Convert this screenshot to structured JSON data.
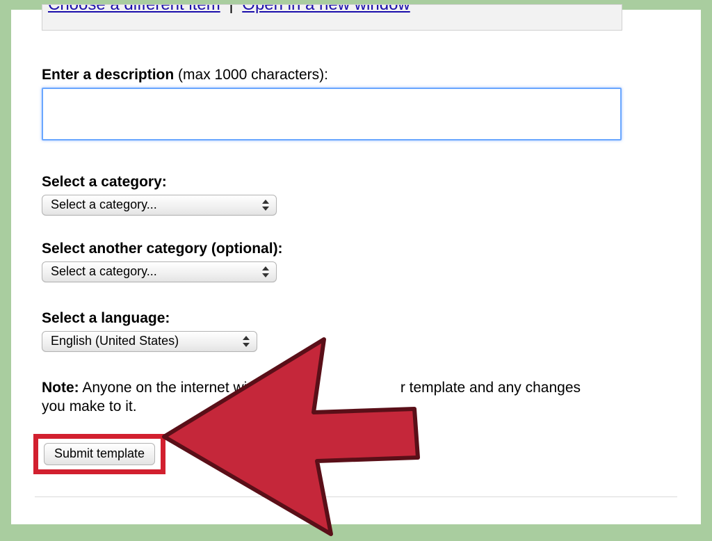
{
  "topbar": {
    "link1": "Choose a different item",
    "sep": "|",
    "link2": "Open in a new window"
  },
  "description": {
    "label_bold": "Enter a description",
    "label_rest": " (max 1000 characters):",
    "value": ""
  },
  "category1": {
    "label": "Select a category:",
    "selected": "Select a category..."
  },
  "category2": {
    "label": "Select another category (optional):",
    "selected": "Select a category..."
  },
  "language": {
    "label": "Select a language:",
    "selected": "English (United States)"
  },
  "note": {
    "bold": "Note:",
    "text_before": " Anyone on the internet wi",
    "text_after": "r template and any changes you make to it."
  },
  "submit": {
    "label": "Submit template"
  }
}
